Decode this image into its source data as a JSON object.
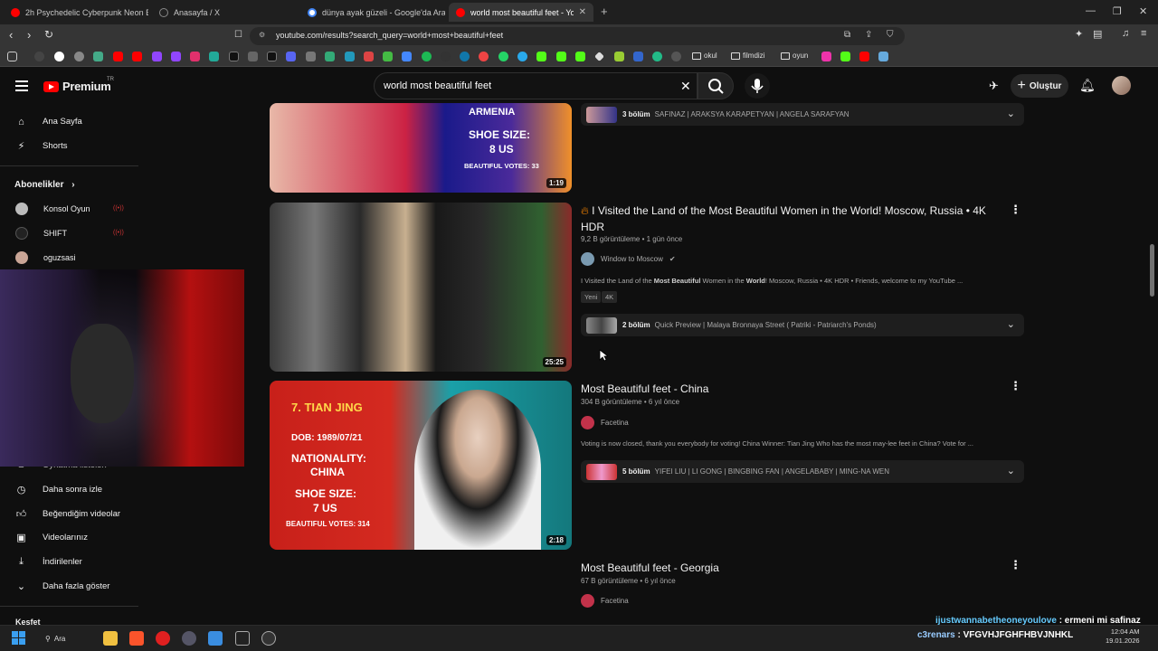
{
  "browser": {
    "tabs": [
      {
        "label": "2h Psychedelic Cyberpunk Neon Bac",
        "color": "#ff0000"
      },
      {
        "label": "Anasayfa / X",
        "color": "#ffffff"
      },
      {
        "label": "dünya ayak güzeli - Google'da Ara",
        "color": "#4285f4"
      },
      {
        "label": "world most beautiful feet - YouT",
        "color": "#ff0000",
        "active": true
      }
    ],
    "url": "youtube.com/results?search_query=world+most+beautiful+feet",
    "bookmarks": {
      "folders": [
        "okul",
        "filmdizi",
        "oyun"
      ]
    }
  },
  "youtube": {
    "logo": "Premium",
    "logo_region": "TR",
    "search_query": "world most beautiful feet",
    "create_label": "Oluştur",
    "sidebar": {
      "home": "Ana Sayfa",
      "shorts": "Shorts",
      "subscriptions_header": "Abonelikler",
      "subscriptions": [
        "Konsol Oyun",
        "SHIFT",
        "oguzsasi"
      ],
      "library_partial": "Oynatma listeleri",
      "watch_later": "Daha sonra izle",
      "liked": "Beğendiğim videolar",
      "your_videos": "Videolarınız",
      "downloads": "İndirilenler",
      "show_more": "Daha fazla göster",
      "bottom_partial": "Keşfet"
    },
    "results": [
      {
        "thumb_text": [
          "ARMENIA",
          "SHOE SIZE:",
          "8 US",
          "BEAUTIFUL VOTES: 33"
        ],
        "duration": "1:19",
        "chapters_count": "3 bölüm",
        "chapters": "SAFINAZ | ARAKSYA KARAPETYAN | ANGELA SARAFYAN"
      },
      {
        "title": "I Visited the Land of the Most Beautiful Women in the World! Moscow, Russia • 4K HDR",
        "views": "9,2 B görüntüleme • 1 gün önce",
        "channel": "Window to Moscow",
        "desc_pre": "I Visited the Land of the ",
        "desc_b1": "Most Beautiful",
        "desc_mid": " Women in the ",
        "desc_b2": "World",
        "desc_post": "! Moscow, Russia • 4K HDR • Friends, welcome to my YouTube ...",
        "chips": [
          "Yeni",
          "4K"
        ],
        "duration": "25:25",
        "chapters_count": "2 bölüm",
        "chapters": "Quick Preview | Malaya Bronnaya Street ( Patriki - Patriarch's Ponds)"
      },
      {
        "title": "Most Beautiful feet - China",
        "views": "304 B görüntüleme • 6 yıl önce",
        "channel": "Facetina",
        "desc": "Voting is now closed, thank you everybody for voting! China Winner: Tian Jing Who has the most may-lee feet in China? Vote for ...",
        "thumb_text": [
          "7. TIAN JING",
          "DOB: 1989/07/21",
          "NATIONALITY:",
          "CHINA",
          "SHOE SIZE:",
          "7 US",
          "BEAUTIFUL VOTES: 314"
        ],
        "duration": "2:18",
        "chapters_count": "5 bölüm",
        "chapters": "YIFEI LIU | LI GONG | BINGBING FAN | ANGELABABY | MING-NA WEN"
      },
      {
        "title": "Most Beautiful feet - Georgia",
        "views": "67 B görüntüleme • 6 yıl önce",
        "channel": "Facetina"
      }
    ]
  },
  "overlay": {
    "chat_line1_user": "ijustwannabetheoneyoulove",
    "chat_line1_msg": " : ermeni mi safinaz",
    "chat_line2_user": "c3renars",
    "chat_line2_msg": " : VFGVHJFGHFHBVJNHKL"
  },
  "taskbar": {
    "search": "Ara",
    "time": "12:04 AM",
    "date": "19.01.2026"
  }
}
